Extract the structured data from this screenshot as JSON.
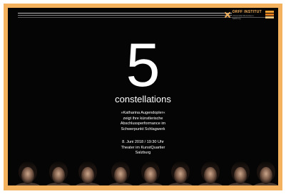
{
  "logo": {
    "name": "ORFF INSTITUT",
    "subline1": "Universität Mozarteum",
    "subline2": "Salzburg"
  },
  "poster": {
    "number": "5",
    "title": "constellations",
    "description_lines": [
      "»Katharina Augendopler«",
      "zeigt ihre künstlerische",
      "Abschlussperformance im",
      "Schwerpunkt Schlagwerk"
    ],
    "event_lines": [
      "8. Juni 2018 / 19:30 Uhr",
      "Theater im KunstQuartier",
      "Salzburg"
    ]
  },
  "colors": {
    "frame": "#f4b25f",
    "background": "#050505",
    "text": "#ffffff",
    "accent": "#f0a030"
  },
  "images": {
    "portrait_row": "row of nine portrait faces along bottom edge"
  }
}
